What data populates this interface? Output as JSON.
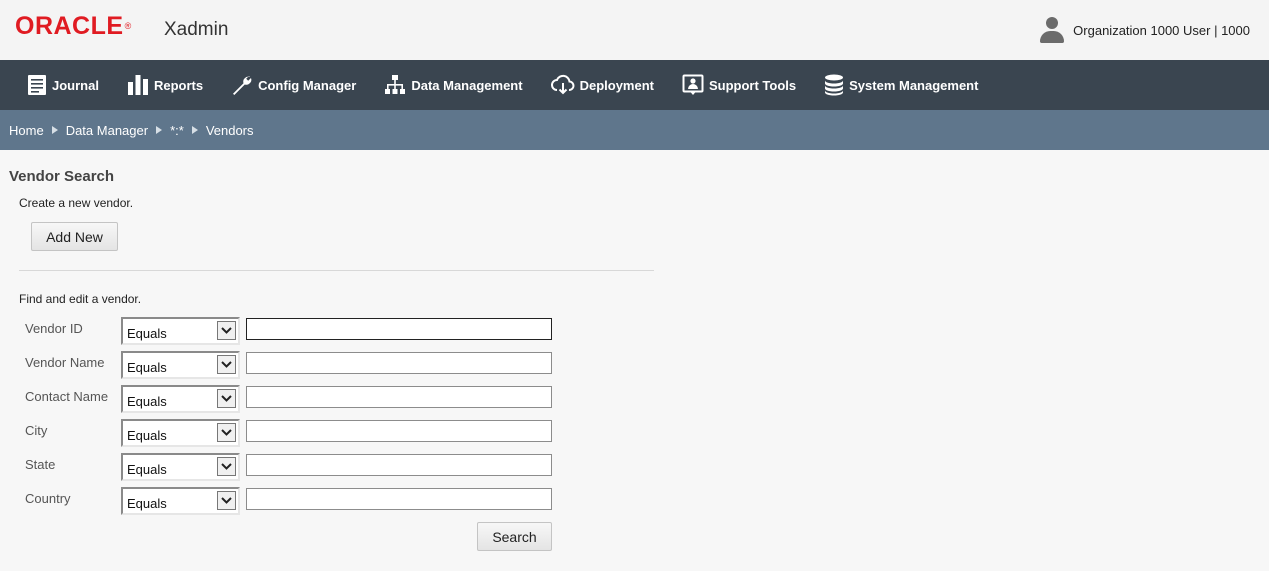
{
  "header": {
    "brand": "ORACLE",
    "brand_reg": "®",
    "app_name": "Xadmin",
    "user_label": "Organization 1000 User | 1000"
  },
  "nav": {
    "items": [
      {
        "label": "Journal",
        "icon": "journal-icon"
      },
      {
        "label": "Reports",
        "icon": "bar-chart-icon"
      },
      {
        "label": "Config Manager",
        "icon": "wrench-icon"
      },
      {
        "label": "Data Management",
        "icon": "hierarchy-icon"
      },
      {
        "label": "Deployment",
        "icon": "cloud-download-icon"
      },
      {
        "label": "Support Tools",
        "icon": "support-person-icon"
      },
      {
        "label": "System Management",
        "icon": "database-icon"
      }
    ]
  },
  "breadcrumb": {
    "items": [
      "Home",
      "Data Manager",
      "*:*",
      "Vendors"
    ]
  },
  "page": {
    "title": "Vendor Search",
    "create_text": "Create a new vendor.",
    "add_new_label": "Add New",
    "find_text": "Find and edit a vendor.",
    "search_label": "Search"
  },
  "filters": [
    {
      "label": "Vendor ID",
      "operator": "Equals",
      "value": ""
    },
    {
      "label": "Vendor Name",
      "operator": "Equals",
      "value": ""
    },
    {
      "label": "Contact Name",
      "operator": "Equals",
      "value": ""
    },
    {
      "label": "City",
      "operator": "Equals",
      "value": ""
    },
    {
      "label": "State",
      "operator": "Equals",
      "value": ""
    },
    {
      "label": "Country",
      "operator": "Equals",
      "value": ""
    }
  ],
  "colors": {
    "brand_red": "#e01b22",
    "navbar": "#3a4550",
    "breadcrumb": "#5f768c"
  }
}
